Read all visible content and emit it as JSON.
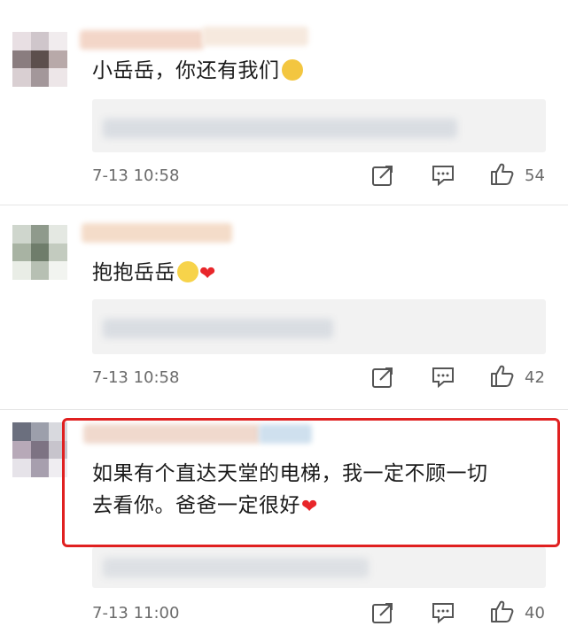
{
  "comments": [
    {
      "text": "小岳岳，你还有我们",
      "emoji": [
        "crying-face"
      ],
      "time": "7-13 10:58",
      "likes": "54"
    },
    {
      "text": "抱抱岳岳",
      "emoji": [
        "sad-face",
        "red-heart"
      ],
      "time": "7-13 10:58",
      "likes": "42"
    },
    {
      "text_line1": "如果有个直达天堂的电梯，我一定不顾一切",
      "text_line2": "去看你。爸爸一定很好",
      "emoji": [
        "red-heart"
      ],
      "time": "7-13 11:00",
      "likes": "40"
    }
  ],
  "icons": {
    "share": "share-icon",
    "comment": "comment-icon",
    "like": "thumbs-up-icon"
  },
  "colors": {
    "highlight_border": "#e02020",
    "heart": "#e8262a",
    "meta_text": "#6b6b6b"
  }
}
